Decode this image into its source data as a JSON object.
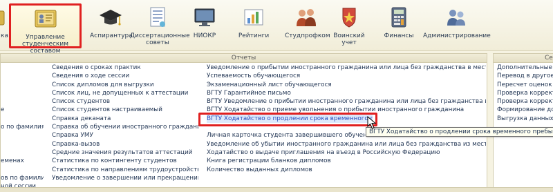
{
  "toolbar": {
    "items": [
      {
        "label": "ка",
        "icon": "folder-icon"
      },
      {
        "label": "Управление\nстуденческим составом",
        "icon": "student-card-icon"
      },
      {
        "label": "Аспирантура",
        "icon": "graduation-cap-icon"
      },
      {
        "label": "Диссертационные\nсоветы",
        "icon": "document-icon"
      },
      {
        "label": "НИОКР",
        "icon": "monitor-icon"
      },
      {
        "label": "Рейтинги",
        "icon": "rating-chart-icon"
      },
      {
        "label": "Студпрофком",
        "icon": "people-icon"
      },
      {
        "label": "Воинский\nучет",
        "icon": "military-badge-icon"
      },
      {
        "label": "Финансы",
        "icon": "calculator-icon"
      },
      {
        "label": "Администрирование",
        "icon": "admin-users-icon"
      }
    ]
  },
  "reports_panel": {
    "title": "Отчеты",
    "col0": [
      "",
      "",
      "",
      "",
      "",
      "е",
      "",
      "о по фамилиям",
      "",
      "",
      "",
      "еменах",
      "",
      "ов по фамилиям",
      "ной сессии"
    ],
    "col1": [
      "Сведения о сроках практик",
      "Сведения о ходе сессии",
      "Список дипломов для выгрузки",
      "Список лиц, не допущенных к аттестации",
      "Список студентов",
      "Список студентов настраиваемый",
      "Справка деканата",
      "Справка об обучении иностранного гражданина",
      "Справка УМУ",
      "Справка-вызов",
      "Средние значения результатов аттестаций",
      "Статистика по контингенту студентов",
      "Статистика по направлениям трудоустройства",
      "Уведомление о завершении или прекращении обучения"
    ],
    "col2": [
      "Уведомление о прибытии иностранного гражданина или лица без гражданства в место пребывания",
      "Успеваемость обучающегося",
      "Экзаменационный лист обучающегося",
      "ВГТУ Гарантийное письмо",
      "ВГТУ Уведомление о прибытии иностранного гражданина или лица без гражданства в место пребывания",
      "ВГТУ Ходатайство о приеме увольнения о прибытии иностранного гражданина",
      "ВГТУ Ходатайство о продлении срока временного пребывания",
      "",
      "Личная карточка студента завершившего обучение",
      "Уведомление об убытии иностранного гражданина или лица без гражданства из места пребывания",
      "Ходатайство о выдаче приглашения на въезд в Российскую Федерацию",
      "Книга регистрации бланков дипломов",
      "Количество выданных дипломов"
    ]
  },
  "services_panel": {
    "title": "Сер",
    "items": [
      "Дополнительные обра",
      "Перевод в другое под",
      "Пересчет оценок",
      "Проверка корректност",
      "Проверка корректност",
      "Формирование докум",
      "Выгрузка данных в ГИ"
    ]
  },
  "tooltip": "ВГТУ Ходатайство о продлении срока временного пребывания"
}
